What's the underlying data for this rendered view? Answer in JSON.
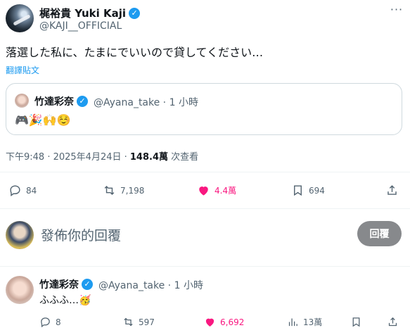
{
  "tweet": {
    "author_name": "梶裕貴 Yuki Kaji",
    "author_handle": "@KAJI__OFFICIAL",
    "more_label": "···",
    "text": "落選した私に、たまにでいいので貸してください…",
    "translate_label": "翻譯貼文",
    "timestamp": "下午9:48 · 2025年4月24日 · ",
    "views_count": "148.4萬",
    "views_label": " 次查看"
  },
  "quote": {
    "author_name": "竹達彩奈",
    "author_handle": "@Ayana_take · 1 小時",
    "text": "🎮🎉🙌☺️"
  },
  "actions": {
    "replies": "84",
    "reposts": "7,198",
    "likes": "4.4萬",
    "bookmarks": "694"
  },
  "composer": {
    "placeholder": "發佈你的回覆",
    "reply_button": "回覆"
  },
  "reply": {
    "author_name": "竹達彩奈",
    "author_handle": "@Ayana_take · 1 小時",
    "text": "ふふふ…🥳",
    "replies": "8",
    "reposts": "597",
    "likes": "6,692",
    "views": "13萬"
  },
  "colors": {
    "accent": "#1d9bf0",
    "like": "#f91880",
    "muted": "#536471"
  },
  "icons": [
    "verified-badge-icon",
    "more-icon",
    "reply-icon",
    "repost-icon",
    "like-icon",
    "bookmark-icon",
    "share-icon",
    "views-icon"
  ]
}
